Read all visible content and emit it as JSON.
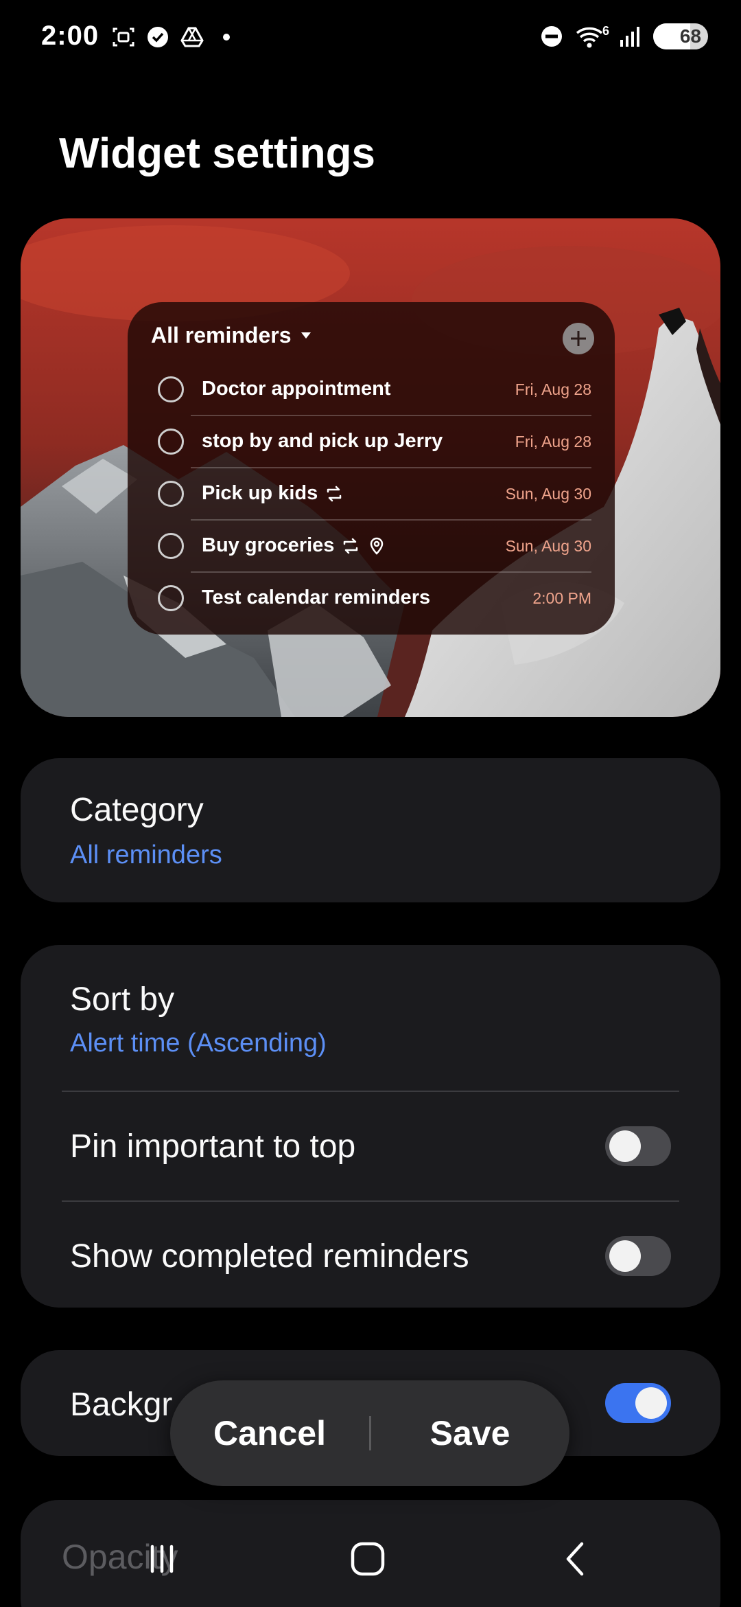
{
  "status_bar": {
    "time": "2:00",
    "wifi_label": "6",
    "battery_level": "68",
    "battery_fraction": 0.68
  },
  "page_title": "Widget settings",
  "widget_preview": {
    "header": "All reminders",
    "reminders": [
      {
        "title": "Doctor appointment",
        "date": "Fri, Aug 28",
        "icons": []
      },
      {
        "title": "stop by and pick up Jerry",
        "date": "Fri, Aug 28",
        "icons": []
      },
      {
        "title": "Pick up kids",
        "date": "Sun, Aug 30",
        "icons": [
          "repeat-icon"
        ]
      },
      {
        "title": "Buy groceries",
        "date": "Sun, Aug 30",
        "icons": [
          "repeat-icon",
          "location-pin-icon"
        ]
      },
      {
        "title": "Test calendar reminders",
        "date": "2:00 PM",
        "icons": []
      }
    ]
  },
  "category": {
    "title": "Category",
    "value": "All reminders"
  },
  "sort": {
    "title": "Sort by",
    "value": "Alert time (Ascending)"
  },
  "pin_important": {
    "label": "Pin important to top",
    "enabled": false
  },
  "show_completed": {
    "label": "Show completed reminders",
    "enabled": false
  },
  "background": {
    "label": "Backgr",
    "enabled": true
  },
  "opacity": {
    "label": "Opacity"
  },
  "actions": {
    "cancel_label": "Cancel",
    "save_label": "Save"
  },
  "colors": {
    "accent": "#5c8ff5",
    "toggle_on": "#3b74f0",
    "date_text": "#f0a48c",
    "card_bg": "#1b1b1e"
  }
}
